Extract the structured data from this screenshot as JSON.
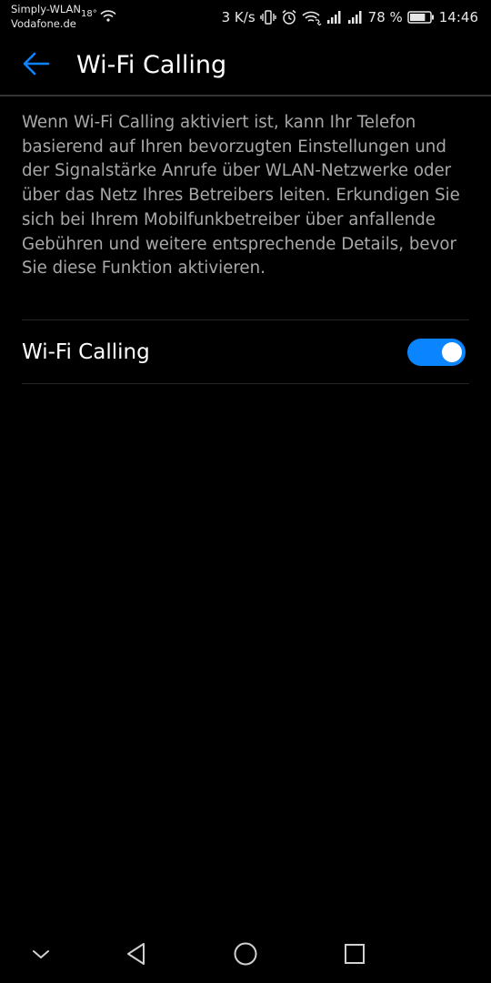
{
  "status_bar": {
    "network_name": "Simply-WLAN",
    "carrier": "Vodafone.de",
    "temperature": "18°",
    "data_speed": "3 K/s",
    "battery_percent": "78 %",
    "battery_level": 78,
    "time": "14:46"
  },
  "app_bar": {
    "title": "Wi-Fi Calling"
  },
  "content": {
    "description": "Wenn Wi-Fi Calling aktiviert ist, kann Ihr Telefon basierend auf Ihren bevorzugten Einstellungen und der Signalstärke Anrufe über WLAN-Netzwerke oder über das Netz Ihres Betreibers leiten. Erkundigen Sie sich bei Ihrem Mobilfunkbetreiber über anfallende Gebühren und weitere entsprechende Details, bevor Sie diese Funktion aktivieren.",
    "setting_label": "Wi-Fi Calling",
    "setting_enabled": true
  },
  "colors": {
    "accent": "#0a84ff",
    "background": "#000000",
    "description_text": "#a8a8a8"
  },
  "icons": {
    "back": "arrow-left-icon",
    "nav_hide": "chevron-down-icon",
    "nav_back": "triangle-back-icon",
    "nav_home": "circle-home-icon",
    "nav_recents": "square-recents-icon"
  }
}
